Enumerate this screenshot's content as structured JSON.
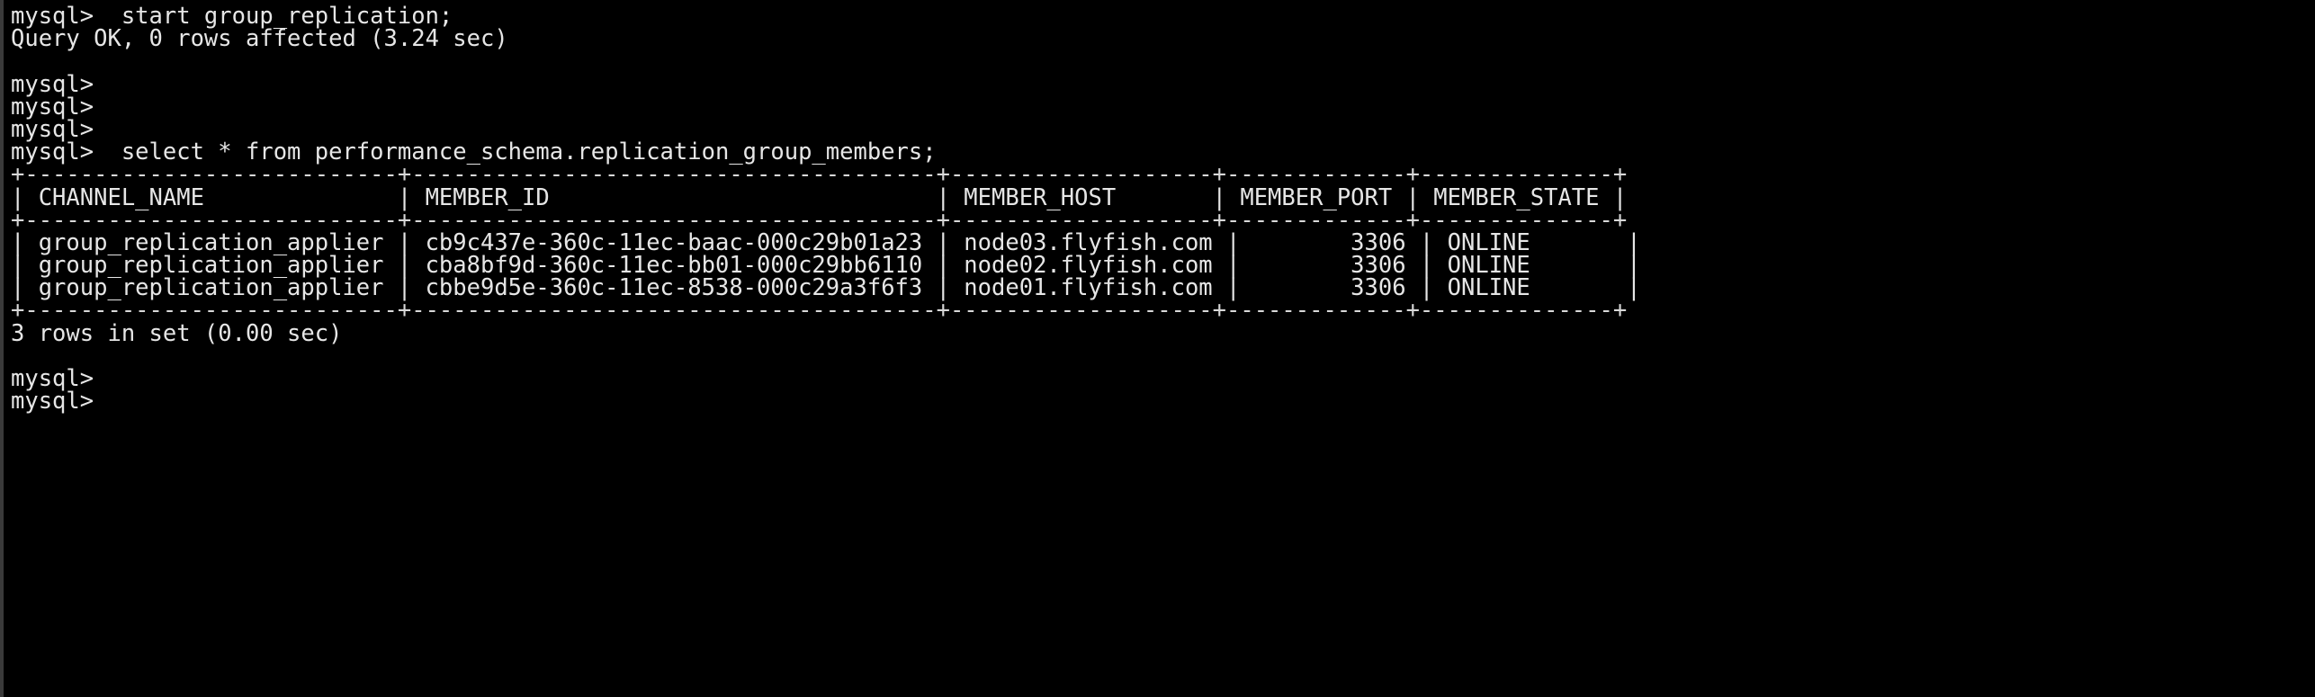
{
  "terminal": {
    "app": "mysql-client-terminal",
    "colors": {
      "background": "#000000",
      "foreground": "#e6e6e6",
      "window_edge": "#3a3a3a"
    },
    "prompt": "mysql>",
    "lines": [
      "mysql>  start group_replication;",
      "Query OK, 0 rows affected (3.24 sec)",
      "",
      "mysql>",
      "mysql>",
      "mysql>",
      "mysql>  select * from performance_schema.replication_group_members;",
      "+---------------------------+--------------------------------------+-------------------+-------------+--------------+",
      "| CHANNEL_NAME              | MEMBER_ID                            | MEMBER_HOST       | MEMBER_PORT | MEMBER_STATE |",
      "+---------------------------+--------------------------------------+-------------------+-------------+--------------+",
      "| group_replication_applier | cb9c437e-360c-11ec-baac-000c29b01a23 | node03.flyfish.com |        3306 | ONLINE       |",
      "| group_replication_applier | cba8bf9d-360c-11ec-bb01-000c29bb6110 | node02.flyfish.com |        3306 | ONLINE       |",
      "| group_replication_applier | cbbe9d5e-360c-11ec-8538-000c29a3f6f3 | node01.flyfish.com |        3306 | ONLINE       |",
      "+---------------------------+--------------------------------------+-------------------+-------------+--------------+",
      "3 rows in set (0.00 sec)",
      "",
      "mysql>",
      "mysql>"
    ],
    "commands": [
      "start group_replication;",
      "select * from performance_schema.replication_group_members;"
    ],
    "status_messages": [
      "Query OK, 0 rows affected (3.24 sec)",
      "3 rows in set (0.00 sec)"
    ],
    "result_table": {
      "columns": [
        "CHANNEL_NAME",
        "MEMBER_ID",
        "MEMBER_HOST",
        "MEMBER_PORT",
        "MEMBER_STATE"
      ],
      "rows": [
        {
          "CHANNEL_NAME": "group_replication_applier",
          "MEMBER_ID": "cb9c437e-360c-11ec-baac-000c29b01a23",
          "MEMBER_HOST": "node03.flyfish.com",
          "MEMBER_PORT": "3306",
          "MEMBER_STATE": "ONLINE"
        },
        {
          "CHANNEL_NAME": "group_replication_applier",
          "MEMBER_ID": "cba8bf9d-360c-11ec-bb01-000c29bb6110",
          "MEMBER_HOST": "node02.flyfish.com",
          "MEMBER_PORT": "3306",
          "MEMBER_STATE": "ONLINE"
        },
        {
          "CHANNEL_NAME": "group_replication_applier",
          "MEMBER_ID": "cbbe9d5e-360c-11ec-8538-000c29a3f6f3",
          "MEMBER_HOST": "node01.flyfish.com",
          "MEMBER_PORT": "3306",
          "MEMBER_STATE": "ONLINE"
        }
      ],
      "row_count_label": "3 rows in set (0.00 sec)"
    }
  }
}
